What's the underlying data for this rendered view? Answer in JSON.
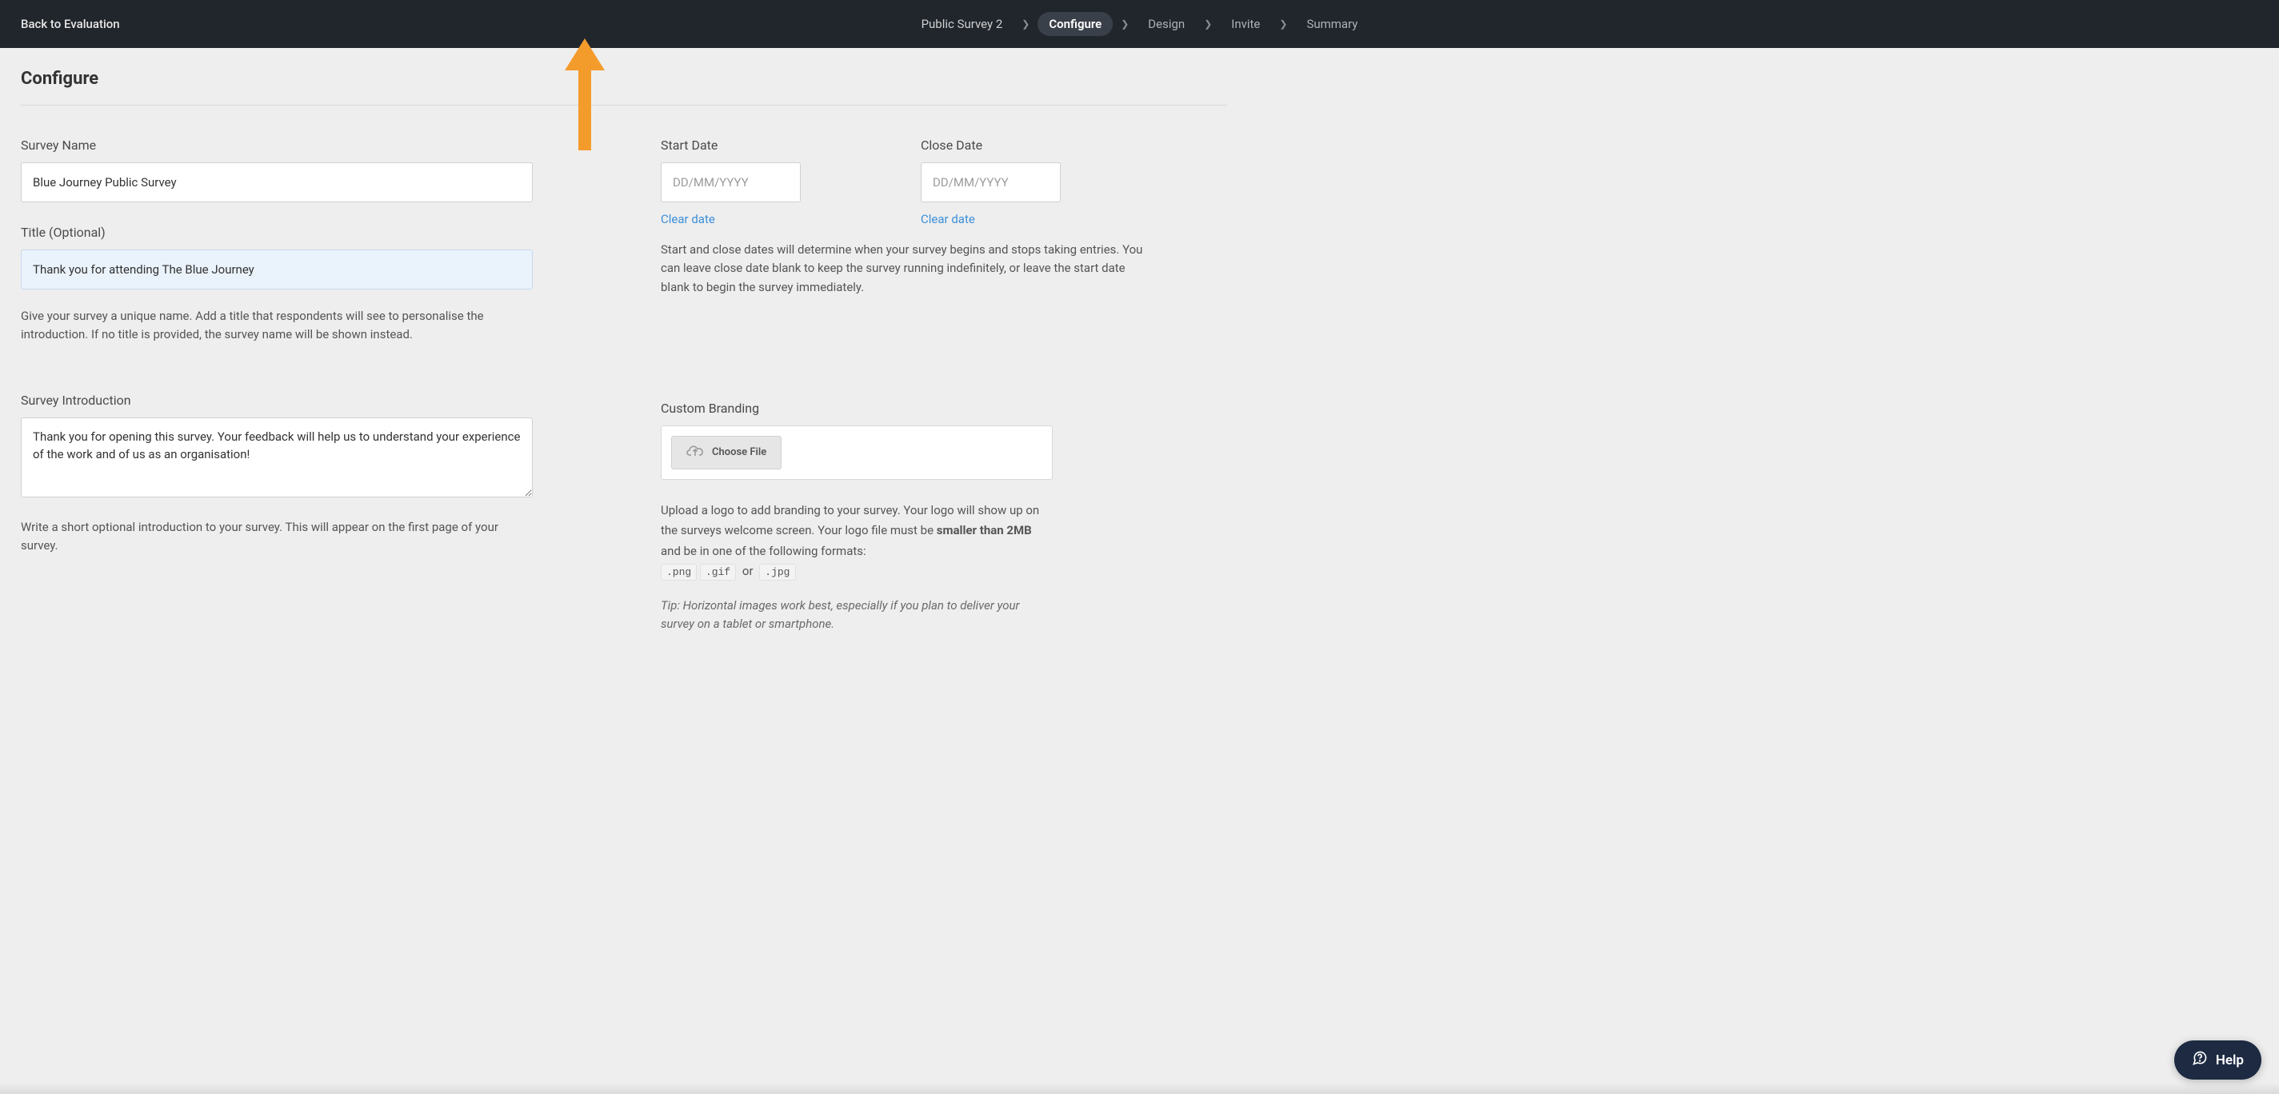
{
  "header": {
    "back_label": "Back to Evaluation",
    "breadcrumb": {
      "survey_name": "Public Survey 2",
      "steps": [
        "Configure",
        "Design",
        "Invite",
        "Summary"
      ],
      "active_step": "Configure"
    }
  },
  "page": {
    "title": "Configure"
  },
  "survey_name": {
    "label": "Survey Name",
    "value": "Blue Journey Public Survey"
  },
  "title_field": {
    "label": "Title (Optional)",
    "value": "Thank you for attending The Blue Journey"
  },
  "name_help": "Give your survey a unique name. Add a title that respondents will see to personalise the introduction. If no title is provided, the survey name will be shown instead.",
  "introduction": {
    "label": "Survey Introduction",
    "value": "Thank you for opening this survey. Your feedback will help us to understand your experience of the work and of us as an organisation!",
    "help": "Write a short optional introduction to your survey. This will appear on the first page of your survey."
  },
  "dates": {
    "start": {
      "label": "Start Date",
      "placeholder": "DD/MM/YYYY",
      "clear": "Clear date"
    },
    "close": {
      "label": "Close Date",
      "placeholder": "DD/MM/YYYY",
      "clear": "Clear date"
    },
    "help": "Start and close dates will determine when your survey begins and stops taking entries. You can leave close date blank to keep the survey running indefinitely, or leave the start date blank to begin the survey immediately."
  },
  "branding": {
    "label": "Custom Branding",
    "choose_file": "Choose File",
    "help_pre": "Upload a logo to add branding to your survey. Your logo will show up on the surveys welcome screen. Your logo file must be ",
    "help_bold": "smaller than 2MB",
    "help_post": " and be in one of the following formats:",
    "formats": [
      ".png",
      ".gif",
      ".jpg"
    ],
    "or": "or",
    "tip": "Tip: Horizontal images work best, especially if you plan to deliver your survey on a tablet or smartphone."
  },
  "help_widget": {
    "label": "Help"
  }
}
